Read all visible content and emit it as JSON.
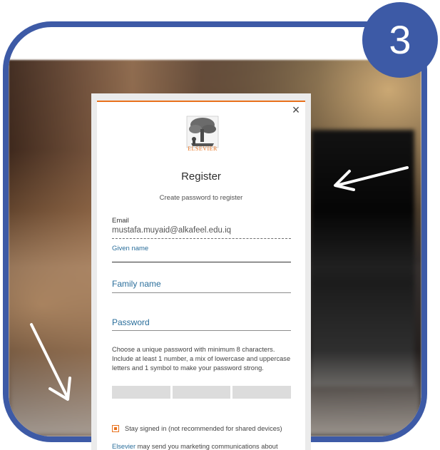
{
  "badge": {
    "number": "3"
  },
  "dialog": {
    "close_symbol": "×",
    "brand": "ELSEVIER",
    "title": "Register",
    "subtitle": "Create password to register",
    "email": {
      "label": "Email",
      "value": "mustafa.muyaid@alkafeel.edu.iq"
    },
    "given_name": {
      "label": "Given name",
      "value": ""
    },
    "family_name": {
      "label": "Family name",
      "value": ""
    },
    "password": {
      "label": "Password",
      "value": "",
      "help_line1": "Choose a unique password with minimum 8 characters.",
      "help_line2": "Include at least 1 number, a mix of lowercase and uppercase",
      "help_line3": "letters and 1 symbol to make your password strong."
    },
    "stay_signed_in": {
      "label": "Stay signed in (not recommended for shared devices)",
      "checked": true
    },
    "marketing": {
      "link": "Elsevier",
      "text": " may send you marketing communications about"
    }
  },
  "colors": {
    "frame": "#3d5aa6",
    "accent": "#e9711c",
    "label_blue": "#2a6e9b"
  },
  "icons": [
    "close-icon",
    "elsevier-tree-logo",
    "arrow-icon"
  ]
}
